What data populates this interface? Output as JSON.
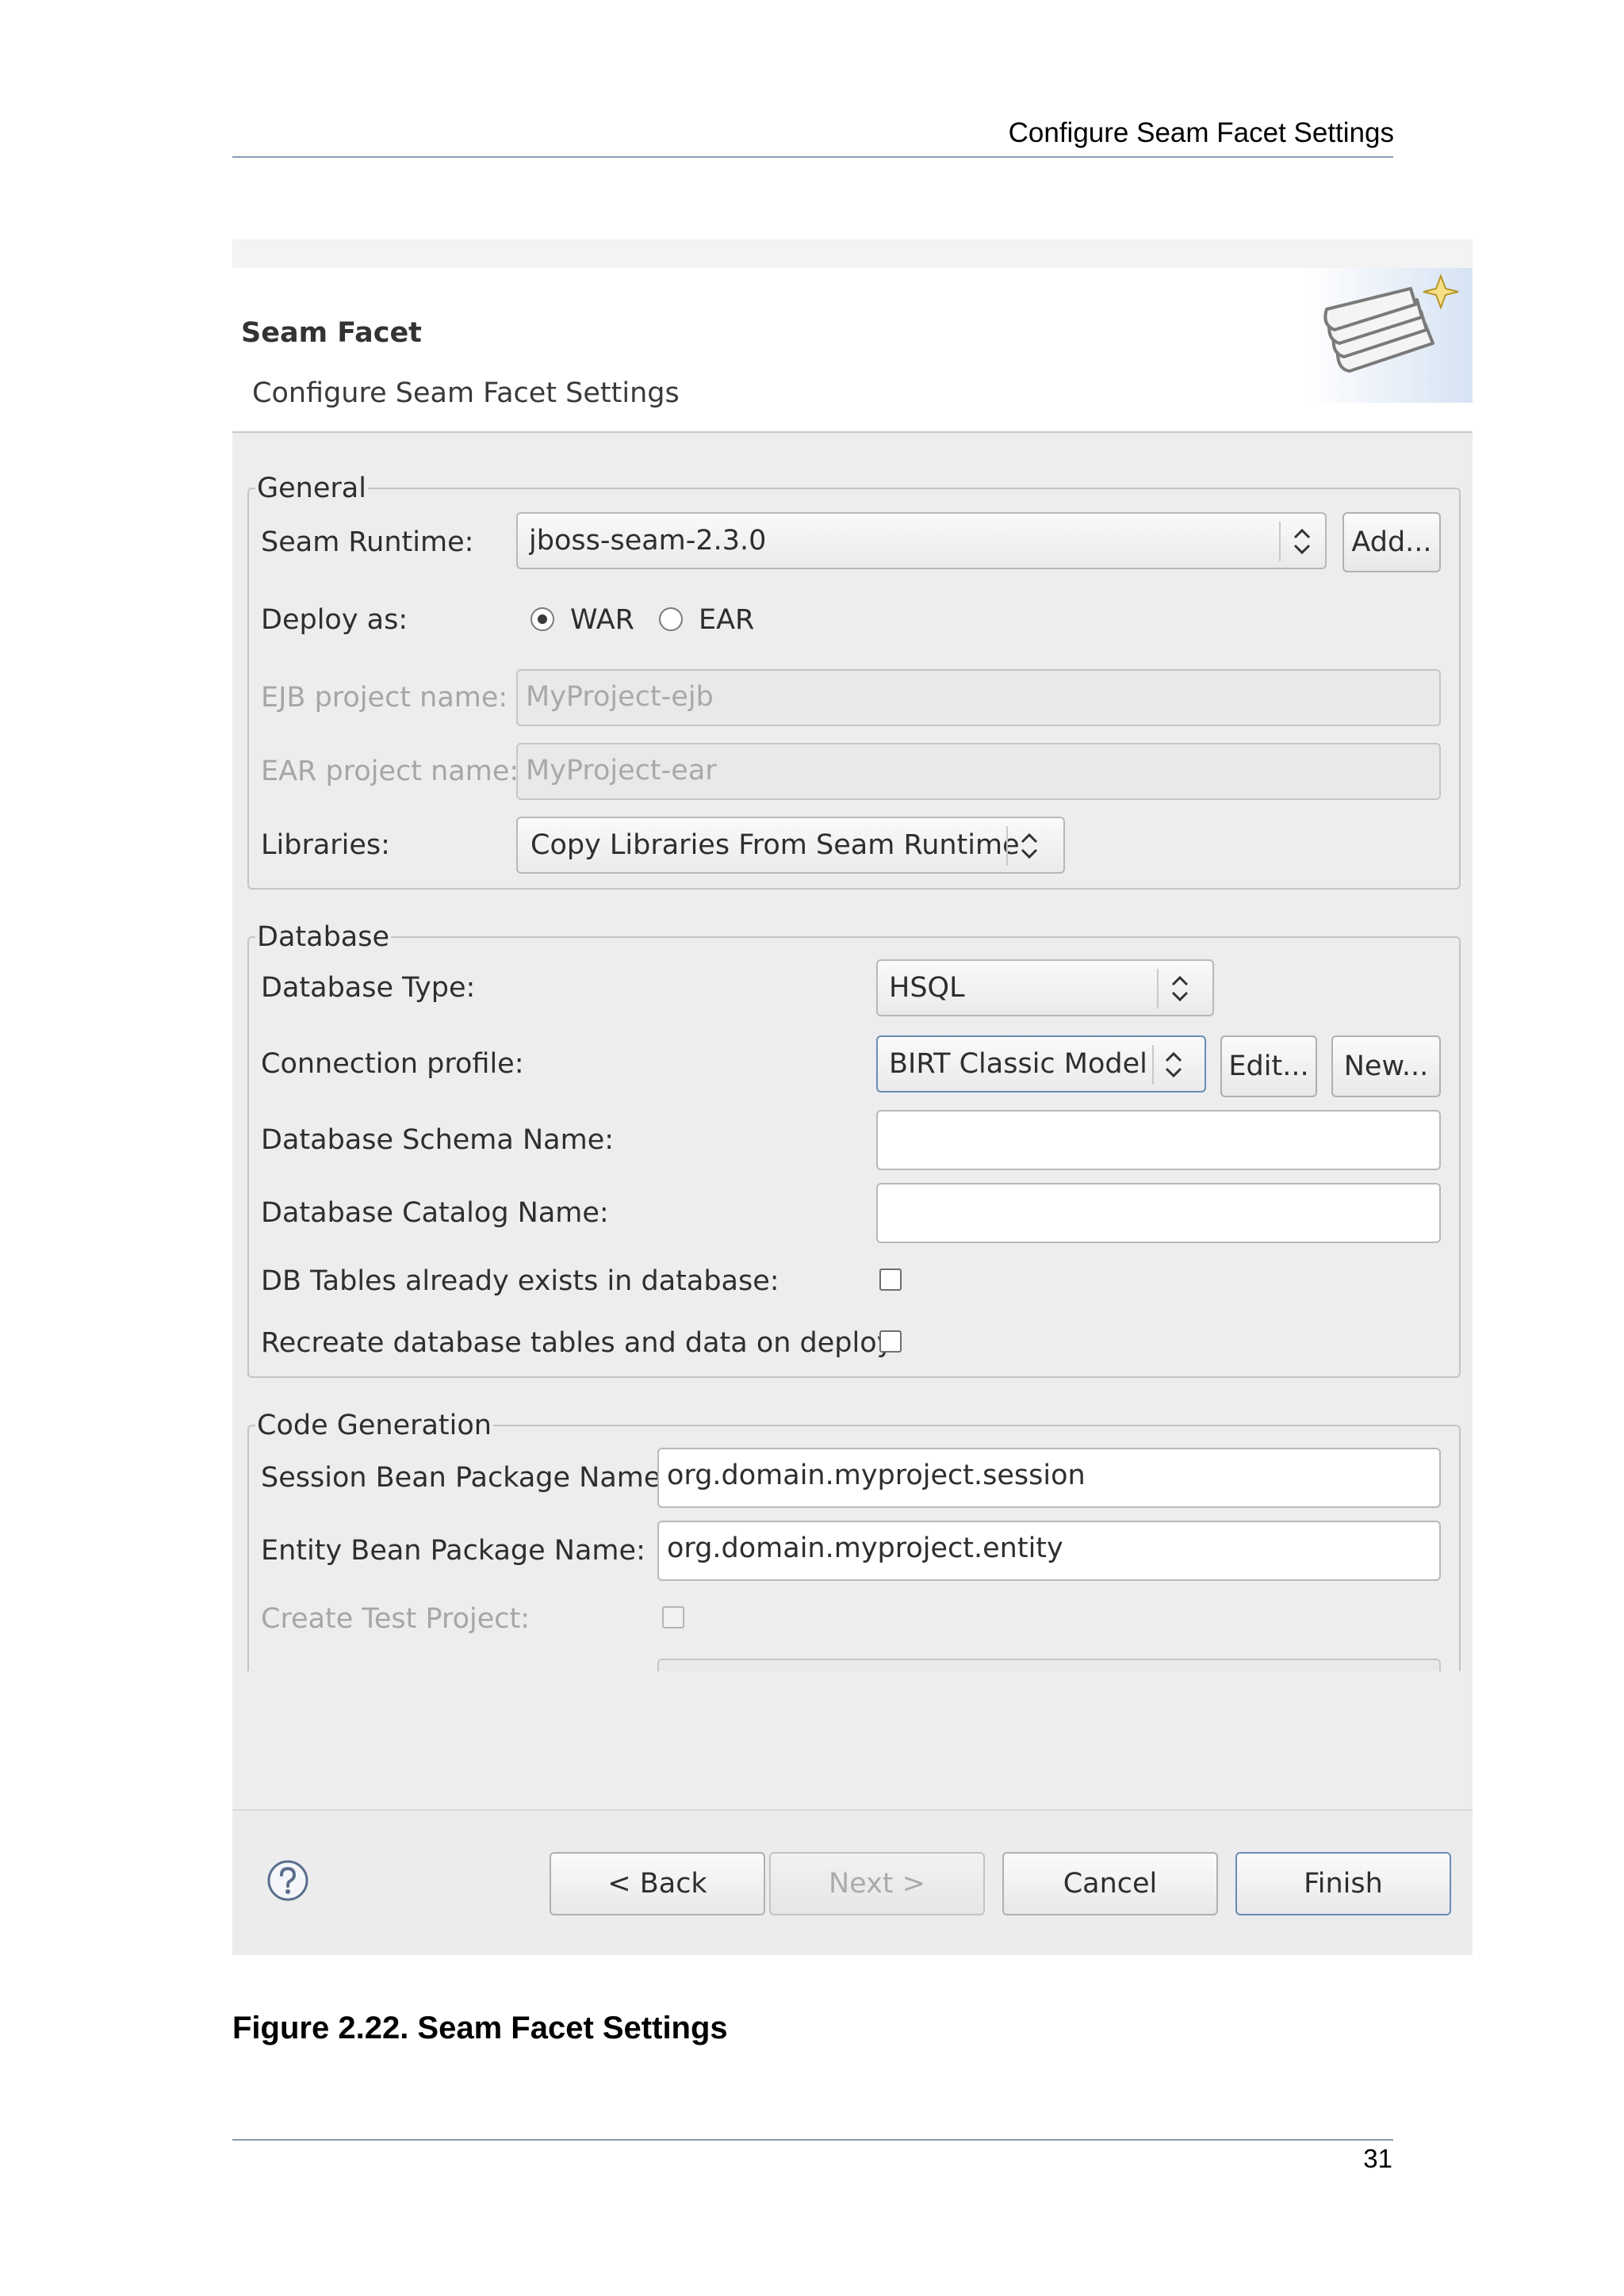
{
  "page": {
    "header_text": "Configure Seam Facet Settings",
    "caption": "Figure 2.22. Seam Facet Settings",
    "page_number": "31"
  },
  "dialog": {
    "banner": {
      "title": "Seam Facet",
      "subtitle": "Configure Seam Facet Settings",
      "icon": "seam-facet-wizard-icon"
    },
    "general": {
      "legend": "General",
      "seam_runtime_label": "Seam Runtime:",
      "seam_runtime_value": "jboss-seam-2.3.0",
      "add_button": "Add...",
      "deploy_as_label": "Deploy as:",
      "deploy_options": [
        "WAR",
        "EAR"
      ],
      "deploy_selected": "WAR",
      "ejb_label": "EJB project name:",
      "ejb_value": "MyProject-ejb",
      "ear_label": "EAR project name:",
      "ear_value": "MyProject-ear",
      "libraries_label": "Libraries:",
      "libraries_value": "Copy Libraries From Seam Runtime"
    },
    "database": {
      "legend": "Database",
      "type_label": "Database Type:",
      "type_value": "HSQL",
      "connection_label": "Connection profile:",
      "connection_value": "BIRT Classic Model:",
      "edit_button": "Edit...",
      "new_button": "New...",
      "schema_label": "Database Schema Name:",
      "schema_value": "",
      "catalog_label": "Database Catalog Name:",
      "catalog_value": "",
      "tables_exist_label": "DB Tables already exists in database:",
      "recreate_label": "Recreate database tables and data on deploy:"
    },
    "codegen": {
      "legend": "Code Generation",
      "session_label": "Session Bean Package Name:",
      "session_value": "org.domain.myproject.session",
      "entity_label": "Entity Bean Package Name:",
      "entity_value": "org.domain.myproject.entity",
      "test_label": "Create Test Project:"
    },
    "buttons": {
      "back": "< Back",
      "next": "Next >",
      "cancel": "Cancel",
      "finish": "Finish"
    }
  }
}
